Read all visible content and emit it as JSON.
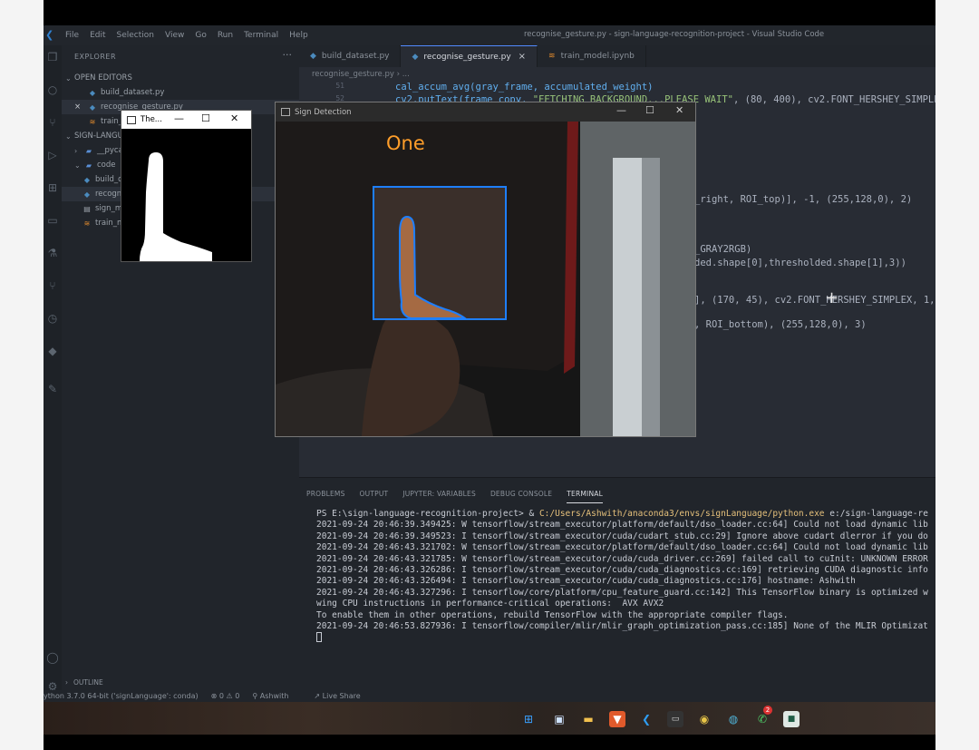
{
  "window": {
    "title": "recognise_gesture.py - sign-language-recognition-project - Visual Studio Code",
    "menu": [
      "File",
      "Edit",
      "Selection",
      "View",
      "Go",
      "Run",
      "Terminal",
      "Help"
    ]
  },
  "explorer": {
    "header": "EXPLORER",
    "more": "···",
    "open_editors_label": "OPEN EDITORS",
    "open_editors": [
      {
        "name": "build_dataset.py",
        "type": "py"
      },
      {
        "name": "recognise_gesture.py",
        "type": "py",
        "close": "×"
      },
      {
        "name": "train_model.ipynb",
        "type": "nb"
      }
    ],
    "project_label": "SIGN-LANGUAGE-RECOGNITION-PROJECT",
    "tree": [
      {
        "name": "__pycache__",
        "type": "folder",
        "chev": "›"
      },
      {
        "name": "code",
        "type": "folder",
        "chev": "⌄"
      },
      {
        "name": "build_dataset.py",
        "type": "py"
      },
      {
        "name": "recognise_gesture.py",
        "type": "py"
      },
      {
        "name": "sign_model.h5",
        "type": "file"
      },
      {
        "name": "train_model.ipynb",
        "type": "nb"
      }
    ],
    "outline_label": "OUTLINE"
  },
  "tabs": [
    {
      "label": "build_dataset.py",
      "icon": "python-icon",
      "active": false
    },
    {
      "label": "recognise_gesture.py",
      "icon": "python-icon",
      "active": true,
      "close": "×"
    },
    {
      "label": "train_model.ipynb",
      "icon": "notebook-icon",
      "active": false
    }
  ],
  "breadcrumb": "recognise_gesture.py › ...",
  "code": {
    "line_51_num": "51",
    "line_51": "cal_accum_avg(gray_frame, accumulated_weight)",
    "line_52_num": "52",
    "line_52_a": "cv2.putText(frame_copy, ",
    "line_52_str": "\"FETCHING BACKGROUND...PLEASE WAIT\"",
    "line_52_b": ", (80, 400), cv2.FONT_HERSHEY_SIMPLEX",
    "frag_1": "_right, ROI_top)], -1, (255,128,0), 2)",
    "frag_2": "_GRAY2RGB)",
    "frag_3": "ded.shape[0],thresholded.shape[1],3))",
    "frag_4": "], (170, 45), cv2.FONT_HERSHEY_SIMPLEX, 1,",
    "frag_5": ", ROI_bottom), (255,128,0), 3)"
  },
  "panel": {
    "tabs": [
      "PROBLEMS",
      "OUTPUT",
      "JUPYTER: VARIABLES",
      "DEBUG CONSOLE",
      "TERMINAL"
    ],
    "active_tab": "TERMINAL",
    "prompt": "PS E:\\sign-language-recognition-project> & ",
    "prompt_path": "C:/Users/Ashwith/anaconda3/envs/signLanguage/python.exe",
    "prompt_rest": " e:/sign-language-re",
    "lines": [
      "2021-09-24 20:46:39.349425: W tensorflow/stream_executor/platform/default/dso_loader.cc:64] Could not load dynamic lib",
      "2021-09-24 20:46:39.349523: I tensorflow/stream_executor/cuda/cudart_stub.cc:29] Ignore above cudart dlerror if you do",
      "2021-09-24 20:46:43.321702: W tensorflow/stream_executor/platform/default/dso_loader.cc:64] Could not load dynamic lib",
      "2021-09-24 20:46:43.321785: W tensorflow/stream_executor/cuda/cuda_driver.cc:269] failed call to cuInit: UNKNOWN ERROR",
      "2021-09-24 20:46:43.326286: I tensorflow/stream_executor/cuda/cuda_diagnostics.cc:169] retrieving CUDA diagnostic info",
      "2021-09-24 20:46:43.326494: I tensorflow/stream_executor/cuda/cuda_diagnostics.cc:176] hostname: Ashwith",
      "2021-09-24 20:46:43.327296: I tensorflow/core/platform/cpu_feature_guard.cc:142] This TensorFlow binary is optimized w",
      "wing CPU instructions in performance-critical operations:  AVX AVX2",
      "To enable them in other operations, rebuild TensorFlow with the appropriate compiler flags.",
      "2021-09-24 20:46:53.827936: I tensorflow/compiler/mlir/mlir_graph_optimization_pass.cc:185] None of the MLIR Optimizat"
    ]
  },
  "status": {
    "interpreter": "ython 3.7.0 64-bit ('signLanguage': conda)",
    "problems": "⊗ 0 ⚠ 0",
    "user": "Ashwith",
    "live_share": "Live Share"
  },
  "thresholded_window": {
    "title": "The...",
    "min": "—",
    "max": "☐",
    "close": "✕"
  },
  "sign_window": {
    "title": "Sign Detection",
    "prediction": "One",
    "min": "—",
    "max": "☐",
    "close": "✕"
  },
  "taskbar": {
    "whatsapp_badge": "2",
    "icons": [
      "windows-start-icon",
      "task-view-icon",
      "file-explorer-icon",
      "brave-browser-icon",
      "vscode-icon",
      "terminal-icon",
      "chrome-icon",
      "browser-icon",
      "whatsapp-icon",
      "camera-app-icon"
    ]
  },
  "colors": {
    "roi_box": "#1e7fff",
    "prediction_text": "#ff9e2a",
    "editor_bg": "#282c34"
  }
}
